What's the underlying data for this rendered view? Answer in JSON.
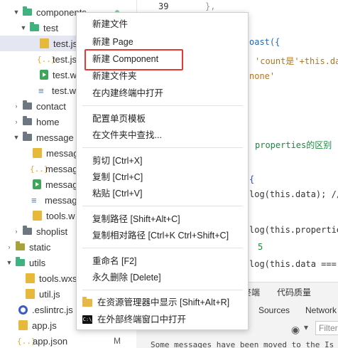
{
  "tree": {
    "items": [
      {
        "label": "components",
        "badge": ""
      },
      {
        "label": "test"
      },
      {
        "label": "test.js"
      },
      {
        "label": "test.js"
      },
      {
        "label": "test.w"
      },
      {
        "label": "test.w"
      },
      {
        "label": "contact"
      },
      {
        "label": "home"
      },
      {
        "label": "message"
      },
      {
        "label": "messag"
      },
      {
        "label": "messag"
      },
      {
        "label": "messag"
      },
      {
        "label": "messag"
      },
      {
        "label": "tools.w"
      },
      {
        "label": "shoplist"
      },
      {
        "label": "static"
      },
      {
        "label": "utils"
      },
      {
        "label": "tools.wxs"
      },
      {
        "label": "util.js"
      },
      {
        "label": ".eslintrc.js"
      },
      {
        "label": "app.js"
      },
      {
        "label": "app.json",
        "badge": "M"
      }
    ]
  },
  "editor": {
    "line_number": "39",
    "lines": [
      "},",
      "oast({",
      "'count是'+this.dat",
      "none'",
      "properties的区别",
      "{",
      "log(this.data); //",
      "log(this.properties",
      "5",
      "log(this.data === "
    ]
  },
  "devtools": {
    "tabs": [
      "终端",
      "代码质量"
    ],
    "tabs2": [
      "Sources",
      "Network"
    ],
    "filter_placeholder": "Filter",
    "console_message": "Some messages have been moved to the Is"
  },
  "menu": {
    "items": {
      "new_file": "新建文件",
      "new_page": "新建 Page",
      "new_component": "新建 Component",
      "new_folder": "新建文件夹",
      "open_in_terminal": "在内建终端中打开",
      "config_template": "配置单页模板",
      "find_in_folder": "在文件夹中查找...",
      "cut": "剪切  [Ctrl+X]",
      "copy": "复制  [Ctrl+C]",
      "paste": "粘贴  [Ctrl+V]",
      "copy_path": "复制路径  [Shift+Alt+C]",
      "copy_relative_path": "复制相对路径  [Ctrl+K Ctrl+Shift+C]",
      "rename": "重命名  [F2]",
      "delete": "永久删除  [Delete]",
      "reveal": "在资源管理器中显示  [Shift+Alt+R]",
      "open_external_terminal": "在外部终端窗口中打开"
    },
    "highlight_color": "#e53935"
  }
}
